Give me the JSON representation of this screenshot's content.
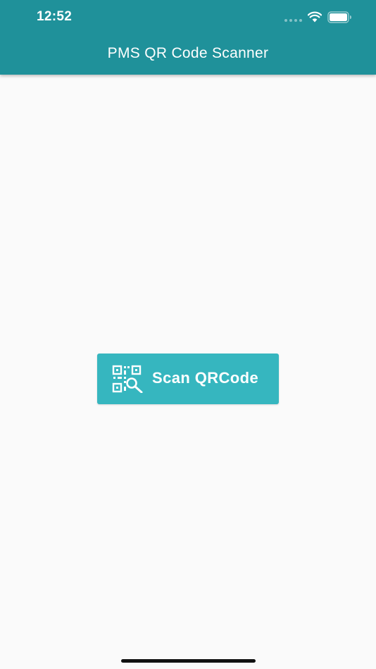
{
  "status_bar": {
    "time": "12:52"
  },
  "app_bar": {
    "title": "PMS QR Code Scanner"
  },
  "main": {
    "scan_button": {
      "label": "Scan QRCode",
      "icon": "qr-search-icon"
    }
  },
  "colors": {
    "app_bar": "#1f919a",
    "button": "#36b6bf",
    "background": "#fafafa",
    "text_on_primary": "#ffffff"
  }
}
